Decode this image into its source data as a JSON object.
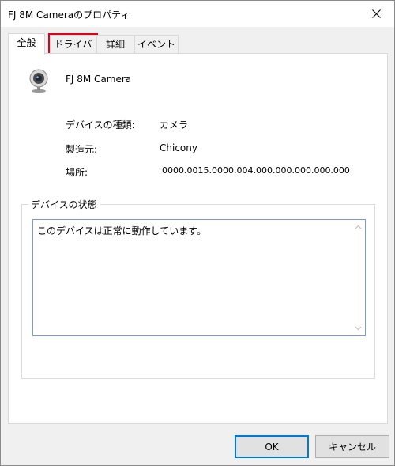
{
  "window": {
    "title": "FJ 8M Cameraのプロパティ"
  },
  "tabs": [
    {
      "label": "全般",
      "active": true
    },
    {
      "label": "ドライバー",
      "highlighted": true
    },
    {
      "label": "詳細"
    },
    {
      "label": "イベント"
    }
  ],
  "device": {
    "name": "FJ 8M Camera",
    "icon": "webcam-icon"
  },
  "properties": [
    {
      "label": "デバイスの種類:",
      "value": "カメラ"
    },
    {
      "label": "製造元:",
      "value": "Chicony"
    },
    {
      "label": "場所:",
      "value": "0000.0015.0000.004.000.000.000.000.000"
    }
  ],
  "status": {
    "group_label": "デバイスの状態",
    "text": "このデバイスは正常に動作しています。"
  },
  "buttons": {
    "ok": "OK",
    "cancel": "キャンセル"
  },
  "colors": {
    "highlight_outline": "#e0001b",
    "default_button_border": "#0078d7"
  }
}
